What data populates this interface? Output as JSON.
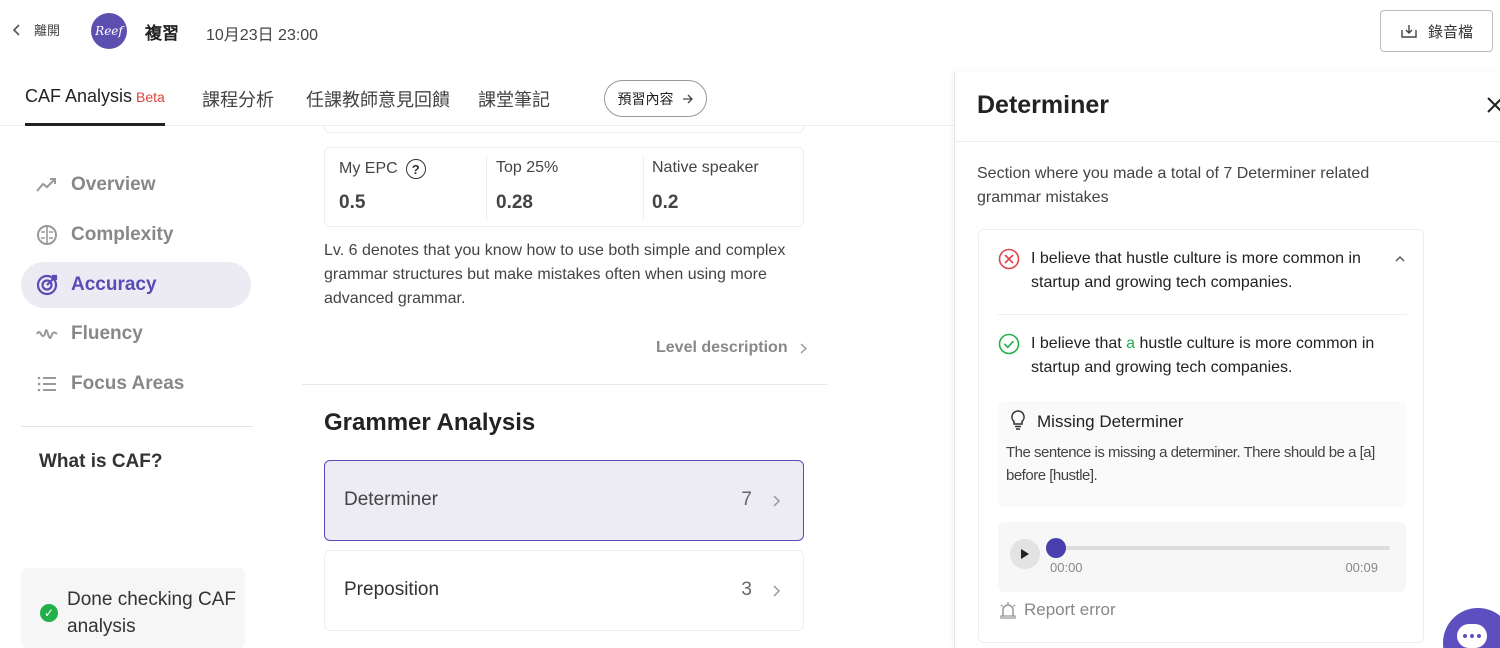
{
  "header": {
    "back_label": "離開",
    "logo_text": "Reef",
    "course_title": "複習",
    "course_datetime": "10月23日 23:00",
    "record_label": "錄音檔"
  },
  "tabs": [
    {
      "label": "CAF Analysis",
      "badge": "Beta",
      "active": true
    },
    {
      "label": "課程分析"
    },
    {
      "label": "任課教師意見回饋"
    },
    {
      "label": "課堂筆記"
    }
  ],
  "preview_button": {
    "label": "預習內容",
    "icon": "arrow-right-icon"
  },
  "sidebar": {
    "items": [
      {
        "label": "Overview",
        "icon": "trend-icon",
        "active": false
      },
      {
        "label": "Complexity",
        "icon": "brain-icon",
        "active": false
      },
      {
        "label": "Accuracy",
        "icon": "target-icon",
        "active": true
      },
      {
        "label": "Fluency",
        "icon": "wave-icon",
        "active": false
      },
      {
        "label": "Focus Areas",
        "icon": "list-icon",
        "active": false
      }
    ],
    "what_is_caf": "What is CAF?",
    "done_text": "Done checking CAF analysis"
  },
  "epc": {
    "my_label": "My EPC",
    "my_value": "0.5",
    "top_label": "Top 25%",
    "top_value": "0.28",
    "native_label": "Native speaker",
    "native_value": "0.2"
  },
  "level_text": "Lv. 6 denotes that you know how to use both simple and complex grammar structures but make mistakes often when using more advanced grammar.",
  "level_link": "Level description",
  "grammar": {
    "title": "Grammer Analysis",
    "rows": [
      {
        "name": "Determiner",
        "count": "7",
        "active": true
      },
      {
        "name": "Preposition",
        "count": "3",
        "active": false
      }
    ]
  },
  "panel": {
    "title": "Determiner",
    "description": "Section where you made a total of 7 Determiner related grammar mistakes",
    "wrong_sentence": "I believe that hustle culture is more common in startup and growing tech companies.",
    "correct_before": "I believe that ",
    "correct_highlight": "a",
    "correct_after": " hustle culture is more common in startup and growing tech companies.",
    "explain_title": "Missing Determiner",
    "explain_text": "The sentence is missing a determiner. There should be a [a] before [hustle].",
    "audio_current": "00:00",
    "audio_total": "00:09",
    "audio_progress": 0,
    "report_label": "Report error"
  },
  "colors": {
    "accent": "#5a4cb5",
    "beta": "#d8453a",
    "correct": "#22b04b",
    "wrong": "#e0434b"
  }
}
